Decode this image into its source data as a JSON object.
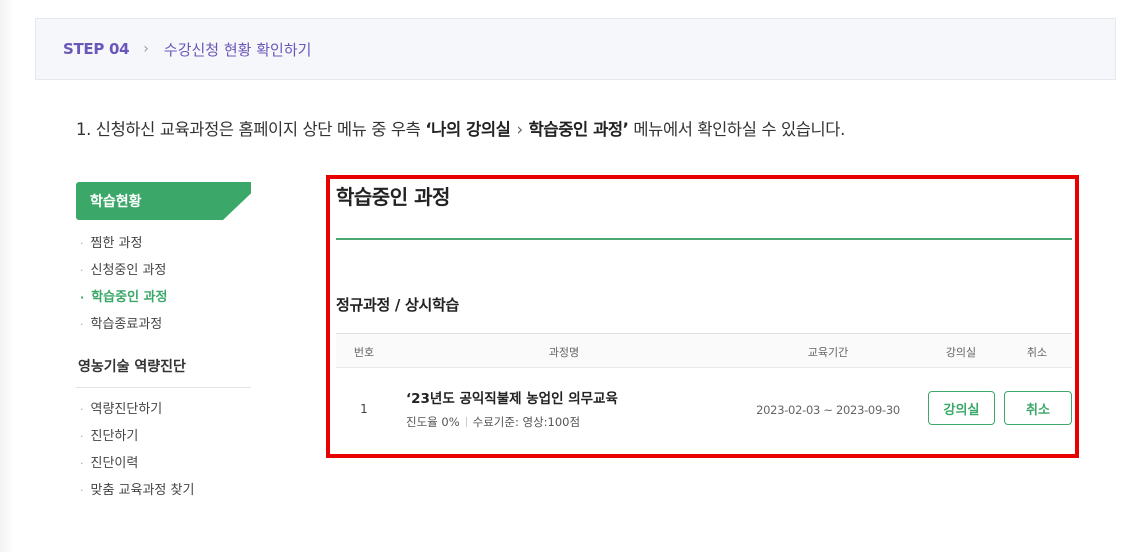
{
  "step": {
    "number": "STEP 04",
    "chevron": "›",
    "title": "수강신청 현황 확인하기"
  },
  "instruction": {
    "prefix": "1. 신청하신 교육과정은 홈페이지 상단 메뉴 중 우측 ",
    "bold_part1": "‘나의 강의실",
    "separator": "›",
    "bold_part2": "학습중인 과정’",
    "suffix": " 메뉴에서 확인하실 수 있습니다."
  },
  "sidebar": {
    "header": "학습현황",
    "items": [
      {
        "label": "찜한 과정",
        "active": false
      },
      {
        "label": "신청중인 과정",
        "active": false
      },
      {
        "label": "학습중인 과정",
        "active": true
      },
      {
        "label": "학습종료과정",
        "active": false
      }
    ],
    "section2_title": "영농기술 역량진단",
    "section2_items": [
      {
        "label": "역량진단하기"
      },
      {
        "label": "진단하기"
      },
      {
        "label": "진단이력"
      },
      {
        "label": "맞춤 교육과정 찾기"
      }
    ],
    "bullet": "·"
  },
  "main": {
    "title": "학습중인 과정",
    "section_title": "정규과정 / 상시학습",
    "table": {
      "headers": {
        "no": "번호",
        "course": "과정명",
        "period": "교육기간",
        "room": "강의실",
        "cancel": "취소"
      },
      "rows": [
        {
          "no": "1",
          "title": "‘23년도 공익직불제 농업인 의무교육",
          "progress": "진도율 0%",
          "criteria": "수료기준: 영상:100점",
          "period": "2023-02-03 ~ 2023-09-30",
          "room_button": "강의실",
          "cancel_button": "취소"
        }
      ]
    }
  },
  "colors": {
    "accent_green": "#3ba86a",
    "step_purple": "#6b57b8",
    "highlight_red": "#e60000"
  }
}
